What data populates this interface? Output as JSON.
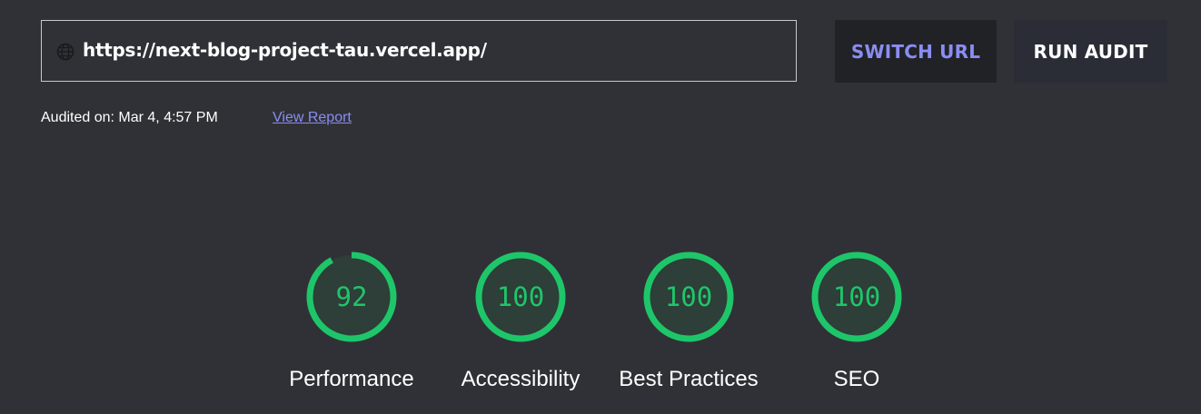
{
  "url_bar": {
    "icon": "globe-icon",
    "value": "https://next-blog-project-tau.vercel.app/"
  },
  "buttons": {
    "switch_url": "SWITCH URL",
    "run_audit": "RUN AUDIT"
  },
  "audit_info": {
    "audited_on": "Audited on: Mar 4, 4:57 PM",
    "view_report": "View Report"
  },
  "colors": {
    "background": "#303136",
    "accent": "#8b8df2",
    "score_good": "#1ec66a",
    "gauge_fill": "#2e3e38"
  },
  "scores": [
    {
      "label": "Performance",
      "value": "92",
      "percent": 92
    },
    {
      "label": "Accessibility",
      "value": "100",
      "percent": 100
    },
    {
      "label": "Best Practices",
      "value": "100",
      "percent": 100
    },
    {
      "label": "SEO",
      "value": "100",
      "percent": 100
    }
  ]
}
